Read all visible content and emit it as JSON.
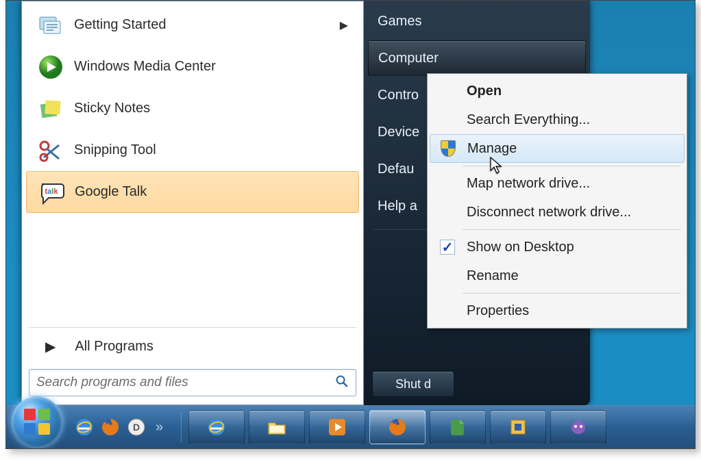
{
  "programs": [
    {
      "id": "getting-started",
      "label": "Getting Started",
      "has_submenu": true
    },
    {
      "id": "wmc",
      "label": "Windows Media Center",
      "has_submenu": false
    },
    {
      "id": "sticky-notes",
      "label": "Sticky Notes",
      "has_submenu": false
    },
    {
      "id": "snipping-tool",
      "label": "Snipping Tool",
      "has_submenu": false
    },
    {
      "id": "google-talk",
      "label": "Google Talk",
      "has_submenu": false,
      "highlighted": true
    }
  ],
  "all_programs_label": "All Programs",
  "search_placeholder": "Search programs and files",
  "right_items": [
    {
      "id": "games",
      "label": "Games"
    },
    {
      "id": "computer",
      "label": "Computer",
      "selected": true
    },
    {
      "id": "control-panel",
      "label": "Contro"
    },
    {
      "id": "devices",
      "label": "Device"
    },
    {
      "id": "default-programs",
      "label": "Defau"
    },
    {
      "id": "help",
      "label": "Help a"
    }
  ],
  "shutdown_label": "Shut d",
  "context_menu": [
    {
      "id": "open",
      "label": "Open",
      "bold": true
    },
    {
      "id": "search-everything",
      "label": "Search Everything..."
    },
    {
      "id": "manage",
      "label": "Manage",
      "icon": "shield",
      "hover": true
    },
    {
      "sep": true
    },
    {
      "id": "map-drive",
      "label": "Map network drive..."
    },
    {
      "id": "disconnect-drive",
      "label": "Disconnect network drive..."
    },
    {
      "sep": true
    },
    {
      "id": "show-desktop",
      "label": "Show on Desktop",
      "icon": "check"
    },
    {
      "id": "rename",
      "label": "Rename"
    },
    {
      "sep": true
    },
    {
      "id": "properties",
      "label": "Properties"
    }
  ],
  "quicklaunch_more": "»",
  "taskbar_buttons": [
    "ie",
    "explorer",
    "wmp",
    "firefox",
    "evernote",
    "vbox",
    "pidgin"
  ]
}
